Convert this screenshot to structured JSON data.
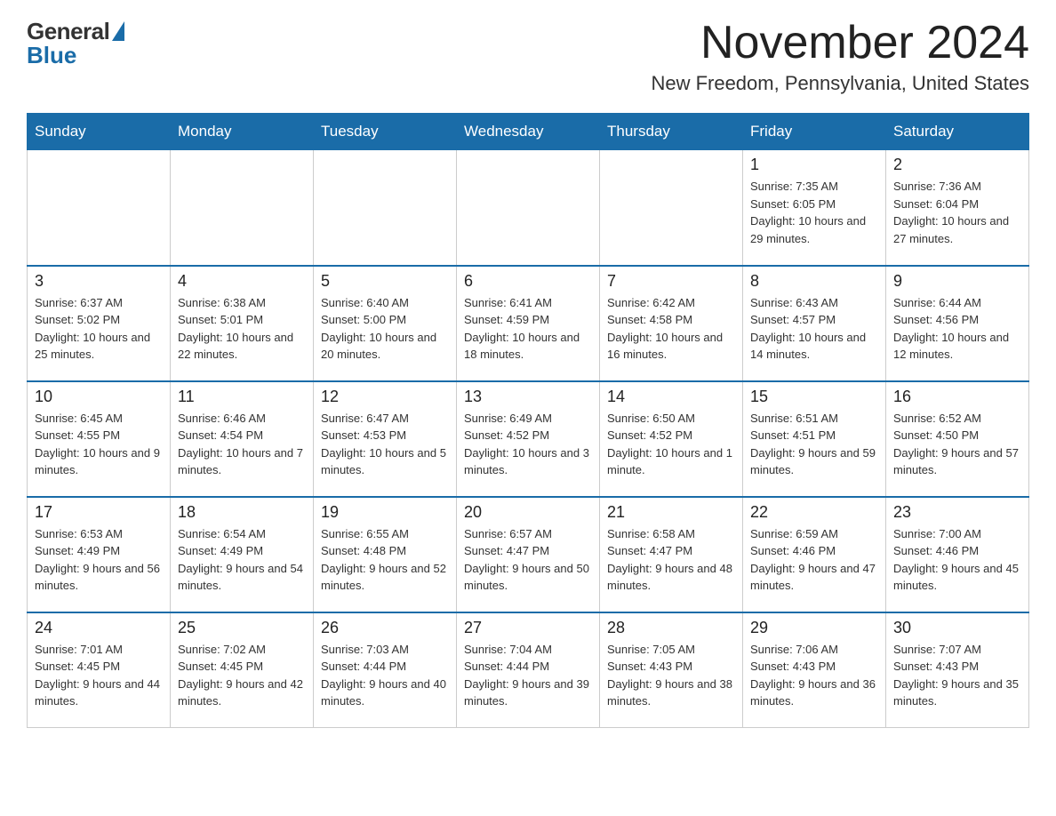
{
  "logo": {
    "general": "General",
    "blue": "Blue"
  },
  "header": {
    "month": "November 2024",
    "location": "New Freedom, Pennsylvania, United States"
  },
  "weekdays": [
    "Sunday",
    "Monday",
    "Tuesday",
    "Wednesday",
    "Thursday",
    "Friday",
    "Saturday"
  ],
  "weeks": [
    [
      {
        "day": "",
        "info": ""
      },
      {
        "day": "",
        "info": ""
      },
      {
        "day": "",
        "info": ""
      },
      {
        "day": "",
        "info": ""
      },
      {
        "day": "",
        "info": ""
      },
      {
        "day": "1",
        "info": "Sunrise: 7:35 AM\nSunset: 6:05 PM\nDaylight: 10 hours and 29 minutes."
      },
      {
        "day": "2",
        "info": "Sunrise: 7:36 AM\nSunset: 6:04 PM\nDaylight: 10 hours and 27 minutes."
      }
    ],
    [
      {
        "day": "3",
        "info": "Sunrise: 6:37 AM\nSunset: 5:02 PM\nDaylight: 10 hours and 25 minutes."
      },
      {
        "day": "4",
        "info": "Sunrise: 6:38 AM\nSunset: 5:01 PM\nDaylight: 10 hours and 22 minutes."
      },
      {
        "day": "5",
        "info": "Sunrise: 6:40 AM\nSunset: 5:00 PM\nDaylight: 10 hours and 20 minutes."
      },
      {
        "day": "6",
        "info": "Sunrise: 6:41 AM\nSunset: 4:59 PM\nDaylight: 10 hours and 18 minutes."
      },
      {
        "day": "7",
        "info": "Sunrise: 6:42 AM\nSunset: 4:58 PM\nDaylight: 10 hours and 16 minutes."
      },
      {
        "day": "8",
        "info": "Sunrise: 6:43 AM\nSunset: 4:57 PM\nDaylight: 10 hours and 14 minutes."
      },
      {
        "day": "9",
        "info": "Sunrise: 6:44 AM\nSunset: 4:56 PM\nDaylight: 10 hours and 12 minutes."
      }
    ],
    [
      {
        "day": "10",
        "info": "Sunrise: 6:45 AM\nSunset: 4:55 PM\nDaylight: 10 hours and 9 minutes."
      },
      {
        "day": "11",
        "info": "Sunrise: 6:46 AM\nSunset: 4:54 PM\nDaylight: 10 hours and 7 minutes."
      },
      {
        "day": "12",
        "info": "Sunrise: 6:47 AM\nSunset: 4:53 PM\nDaylight: 10 hours and 5 minutes."
      },
      {
        "day": "13",
        "info": "Sunrise: 6:49 AM\nSunset: 4:52 PM\nDaylight: 10 hours and 3 minutes."
      },
      {
        "day": "14",
        "info": "Sunrise: 6:50 AM\nSunset: 4:52 PM\nDaylight: 10 hours and 1 minute."
      },
      {
        "day": "15",
        "info": "Sunrise: 6:51 AM\nSunset: 4:51 PM\nDaylight: 9 hours and 59 minutes."
      },
      {
        "day": "16",
        "info": "Sunrise: 6:52 AM\nSunset: 4:50 PM\nDaylight: 9 hours and 57 minutes."
      }
    ],
    [
      {
        "day": "17",
        "info": "Sunrise: 6:53 AM\nSunset: 4:49 PM\nDaylight: 9 hours and 56 minutes."
      },
      {
        "day": "18",
        "info": "Sunrise: 6:54 AM\nSunset: 4:49 PM\nDaylight: 9 hours and 54 minutes."
      },
      {
        "day": "19",
        "info": "Sunrise: 6:55 AM\nSunset: 4:48 PM\nDaylight: 9 hours and 52 minutes."
      },
      {
        "day": "20",
        "info": "Sunrise: 6:57 AM\nSunset: 4:47 PM\nDaylight: 9 hours and 50 minutes."
      },
      {
        "day": "21",
        "info": "Sunrise: 6:58 AM\nSunset: 4:47 PM\nDaylight: 9 hours and 48 minutes."
      },
      {
        "day": "22",
        "info": "Sunrise: 6:59 AM\nSunset: 4:46 PM\nDaylight: 9 hours and 47 minutes."
      },
      {
        "day": "23",
        "info": "Sunrise: 7:00 AM\nSunset: 4:46 PM\nDaylight: 9 hours and 45 minutes."
      }
    ],
    [
      {
        "day": "24",
        "info": "Sunrise: 7:01 AM\nSunset: 4:45 PM\nDaylight: 9 hours and 44 minutes."
      },
      {
        "day": "25",
        "info": "Sunrise: 7:02 AM\nSunset: 4:45 PM\nDaylight: 9 hours and 42 minutes."
      },
      {
        "day": "26",
        "info": "Sunrise: 7:03 AM\nSunset: 4:44 PM\nDaylight: 9 hours and 40 minutes."
      },
      {
        "day": "27",
        "info": "Sunrise: 7:04 AM\nSunset: 4:44 PM\nDaylight: 9 hours and 39 minutes."
      },
      {
        "day": "28",
        "info": "Sunrise: 7:05 AM\nSunset: 4:43 PM\nDaylight: 9 hours and 38 minutes."
      },
      {
        "day": "29",
        "info": "Sunrise: 7:06 AM\nSunset: 4:43 PM\nDaylight: 9 hours and 36 minutes."
      },
      {
        "day": "30",
        "info": "Sunrise: 7:07 AM\nSunset: 4:43 PM\nDaylight: 9 hours and 35 minutes."
      }
    ]
  ]
}
